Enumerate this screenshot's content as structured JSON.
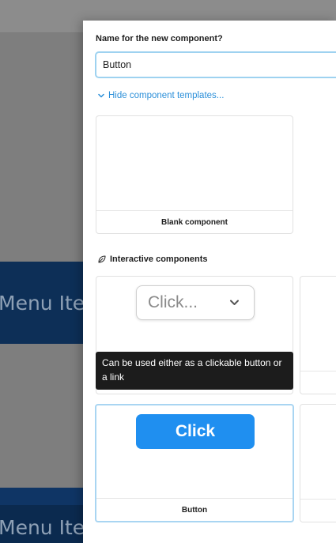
{
  "background": {
    "menu_item_1": "Menu Item",
    "menu_item_2": "Menu Item"
  },
  "panel": {
    "name_label": "Name for the new component?",
    "name_input_value": "Button",
    "toggle_templates_label": "Hide component templates...",
    "blank_card": {
      "caption": "Blank component"
    },
    "interactive_section_title": "Interactive components",
    "dropdown_card": {
      "preview_text": "Click..."
    },
    "button_card": {
      "preview_text": "Click",
      "caption": "Button"
    },
    "tooltip_text": "Can be used either as a clickable button or a link"
  },
  "colors": {
    "accent": "#1f8ff0",
    "link": "#2b8fd9",
    "input_focus_border": "#9ed2f0",
    "tooltip_bg": "#1c1c1c",
    "background_menu": "#0d2f57"
  },
  "icons": {
    "toggle": "chevron-down-icon",
    "section": "leaf-icon",
    "dropdown_arrow": "chevron-down-icon"
  }
}
